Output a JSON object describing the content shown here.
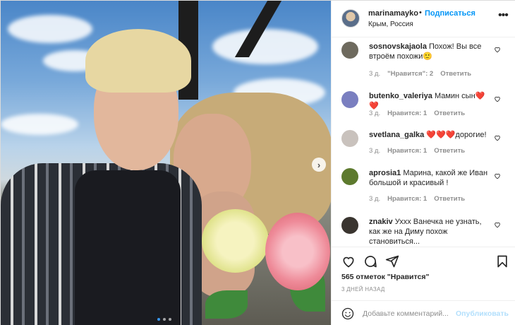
{
  "header": {
    "username": "marinamayko",
    "separator": "•",
    "follow_label": "Подписаться",
    "location": "Крым, Россия",
    "more_icon": "more-horizontal-icon"
  },
  "comments": [
    {
      "username": "sosnovskajaola",
      "text": "Похож! Вы все втроём похожи🙂",
      "time": "3 д.",
      "likes": "\"Нравится\": 2",
      "reply": "Ответить",
      "avatar_color": "#6e6a5e"
    },
    {
      "username": "butenko_valeriya",
      "text": "Мамин сын❤️❤️",
      "time": "3 д.",
      "likes": "Нравится: 1",
      "reply": "Ответить",
      "avatar_color": "#7a7fc0"
    },
    {
      "username": "svetlana_galka",
      "text": "❤️❤️❤️дорогие!",
      "time": "3 д.",
      "likes": "Нравится: 1",
      "reply": "Ответить",
      "avatar_color": "#c9c2bd"
    },
    {
      "username": "aprosia1",
      "text": "Марина, какой же Иван большой и красивый !",
      "time": "3 д.",
      "likes": "Нравится: 1",
      "reply": "Ответить",
      "avatar_color": "#5d7a2e"
    },
    {
      "username": "znakiv",
      "text": "Уххх Ванечка не узнать, как же на Диму похож становиться...",
      "time": "",
      "likes": "",
      "reply": "",
      "avatar_color": "#3a3530"
    }
  ],
  "actions": {
    "like_icon": "heart-icon",
    "comment_icon": "comment-icon",
    "share_icon": "paper-plane-icon",
    "save_icon": "bookmark-icon"
  },
  "likes_text": "565 отметок \"Нравится\"",
  "post_time": "3 ДНЕЙ НАЗАД",
  "add_comment": {
    "placeholder": "Добавьте комментарий...",
    "publish_label": "Опубликовать"
  },
  "media": {
    "next_icon": "chevron-right-icon",
    "carousel_count": 3,
    "carousel_active": 1
  }
}
